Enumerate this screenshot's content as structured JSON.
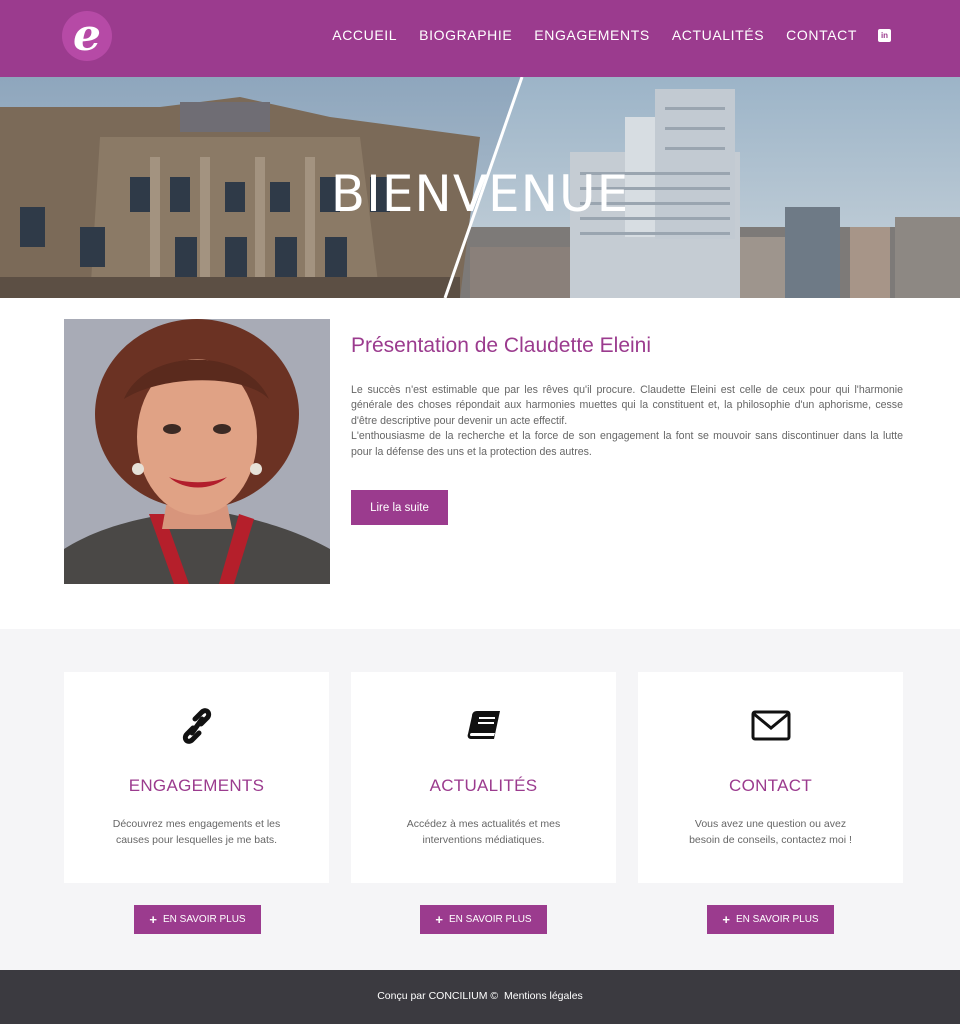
{
  "header": {
    "logo_letter": "e",
    "nav": [
      {
        "label": "ACCUEIL"
      },
      {
        "label": "BIOGRAPHIE"
      },
      {
        "label": "ENGAGEMENTS"
      },
      {
        "label": "ACTUALITÉS"
      },
      {
        "label": "CONTACT"
      }
    ],
    "linkedin_label": "in"
  },
  "hero": {
    "title": "BIENVENUE"
  },
  "presentation": {
    "title": "Présentation de Claudette Eleini",
    "paragraph1": "Le succès n'est estimable que par les rêves qu'il procure. Claudette Eleini est celle de ceux pour qui l'harmonie générale des choses répondait aux harmonies muettes qui la constituent et, la philosophie d'un aphorisme, cesse d'être descriptive pour devenir un acte effectif.",
    "paragraph2": "L'enthousiasme de la recherche et la force de son engagement la font se mouvoir sans discontinuer dans la lutte pour la défense des uns et la protection des autres.",
    "button_label": "Lire la suite"
  },
  "cards": [
    {
      "icon": "link-icon",
      "title": "ENGAGEMENTS",
      "text": "Découvrez mes engagements et les causes pour lesquelles je me bats.",
      "button_label": "EN SAVOIR PLUS"
    },
    {
      "icon": "book-icon",
      "title": "ACTUALITÉS",
      "text": "Accédez à mes actualités et mes interventions médiatiques.",
      "button_label": "EN SAVOIR PLUS"
    },
    {
      "icon": "envelope-icon",
      "title": "CONTACT",
      "text": "Vous avez une question ou avez besoin de conseils, contactez moi !",
      "button_label": "EN SAVOIR PLUS"
    }
  ],
  "footer": {
    "credit": "Conçu par CONCILIUM ©",
    "legal": "Mentions légales"
  },
  "colors": {
    "brand": "#9b3b8e",
    "footer": "#3b3a40",
    "background": "#f5f5f7"
  }
}
